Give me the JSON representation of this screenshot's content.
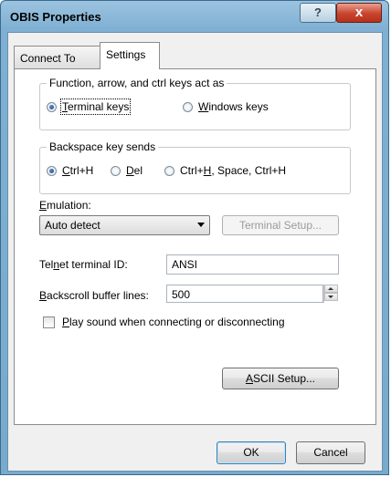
{
  "window": {
    "title": "OBIS Properties",
    "help_label": "?",
    "close_label": "x"
  },
  "tabs": [
    {
      "label": "Connect To",
      "active": false
    },
    {
      "label": "Settings",
      "active": true
    }
  ],
  "keys_group": {
    "legend": "Function, arrow, and ctrl keys act as",
    "options": [
      {
        "mnemonic": "T",
        "rest": "erminal keys",
        "checked": true
      },
      {
        "mnemonic": "W",
        "rest": "indows keys",
        "checked": false
      }
    ]
  },
  "backspace_group": {
    "legend": "Backspace key sends",
    "options": [
      {
        "pre": "",
        "mnemonic": "C",
        "rest": "trl+H",
        "checked": true
      },
      {
        "pre": "",
        "mnemonic": "D",
        "rest": "el",
        "checked": false
      },
      {
        "pre": "Ctrl+",
        "mnemonic": "H",
        "rest": ", Space, Ctrl+H",
        "checked": false
      }
    ]
  },
  "emulation": {
    "label_mnemonic": "E",
    "label_rest": "mulation:",
    "value": "Auto detect",
    "terminal_setup_button": "Terminal Setup..."
  },
  "telnet": {
    "label_pre": "Tel",
    "label_mnemonic": "n",
    "label_rest": "et terminal ID:",
    "value": "ANSI"
  },
  "backscroll": {
    "label_mnemonic": "B",
    "label_rest": "ackscroll buffer lines:",
    "value": "500"
  },
  "play_sound": {
    "mnemonic": "P",
    "rest": "lay sound when connecting or disconnecting",
    "checked": false
  },
  "ascii_setup_button": {
    "mnemonic": "A",
    "rest": "SCII Setup..."
  },
  "footer": {
    "ok_label": "OK",
    "cancel_label": "Cancel"
  }
}
